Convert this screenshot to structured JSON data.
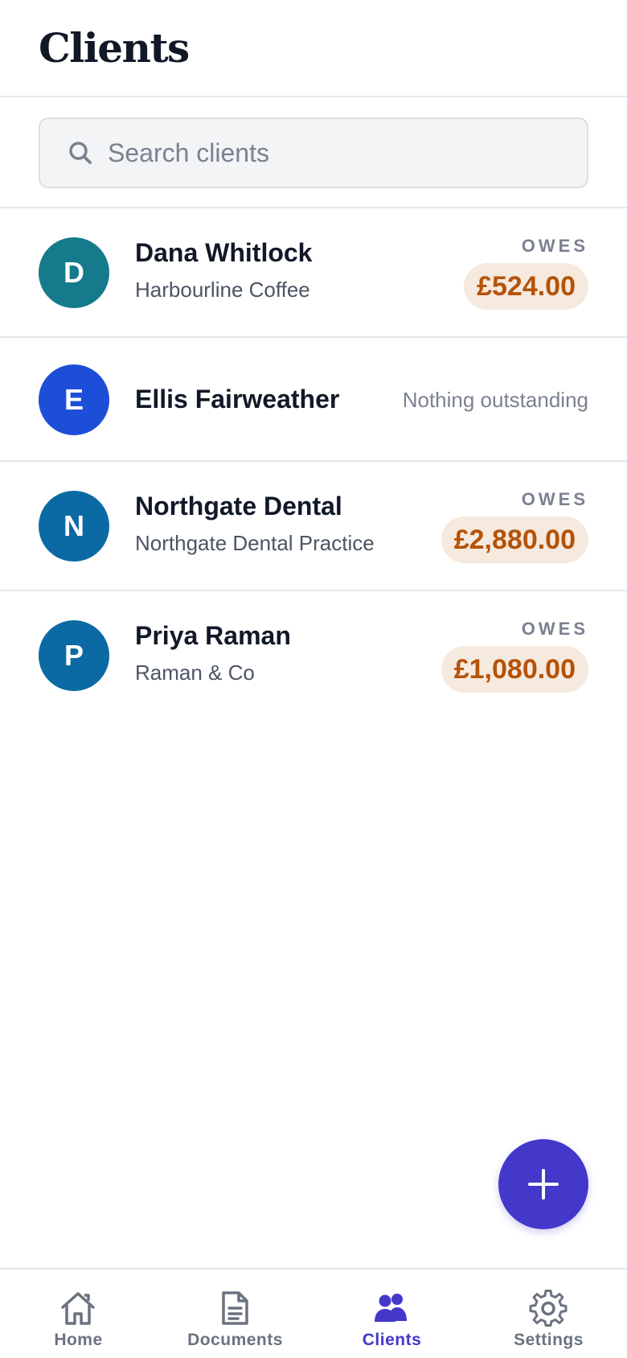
{
  "header": {
    "title": "Clients"
  },
  "search": {
    "placeholder": "Search clients",
    "value": ""
  },
  "clients": [
    {
      "initial": "D",
      "name": "Dana Whitlock",
      "company": "Harbourline Coffee",
      "status_label": "OWES",
      "amount": "£524.00",
      "avatar_color": "#157a8c"
    },
    {
      "initial": "E",
      "name": "Ellis Fairweather",
      "company": "",
      "status_text": "Nothing outstanding",
      "avatar_color": "#1d4ed8"
    },
    {
      "initial": "N",
      "name": "Northgate Dental",
      "company": "Northgate Dental Practice",
      "status_label": "OWES",
      "amount": "£2,880.00",
      "avatar_color": "#0b6aa3"
    },
    {
      "initial": "P",
      "name": "Priya Raman",
      "company": "Raman & Co",
      "status_label": "OWES",
      "amount": "£1,080.00",
      "avatar_color": "#0b6aa3"
    }
  ],
  "fab": {
    "icon": "plus-icon"
  },
  "nav": {
    "items": [
      {
        "label": "Home",
        "icon": "home-icon",
        "active": false
      },
      {
        "label": "Documents",
        "icon": "document-icon",
        "active": false
      },
      {
        "label": "Clients",
        "icon": "users-icon",
        "active": true
      },
      {
        "label": "Settings",
        "icon": "gear-icon",
        "active": false
      }
    ]
  },
  "colors": {
    "accent": "#4338ca",
    "owes_badge_bg": "#f6e9de",
    "owes_amount": "#b45309",
    "muted_text": "#7b8190"
  }
}
